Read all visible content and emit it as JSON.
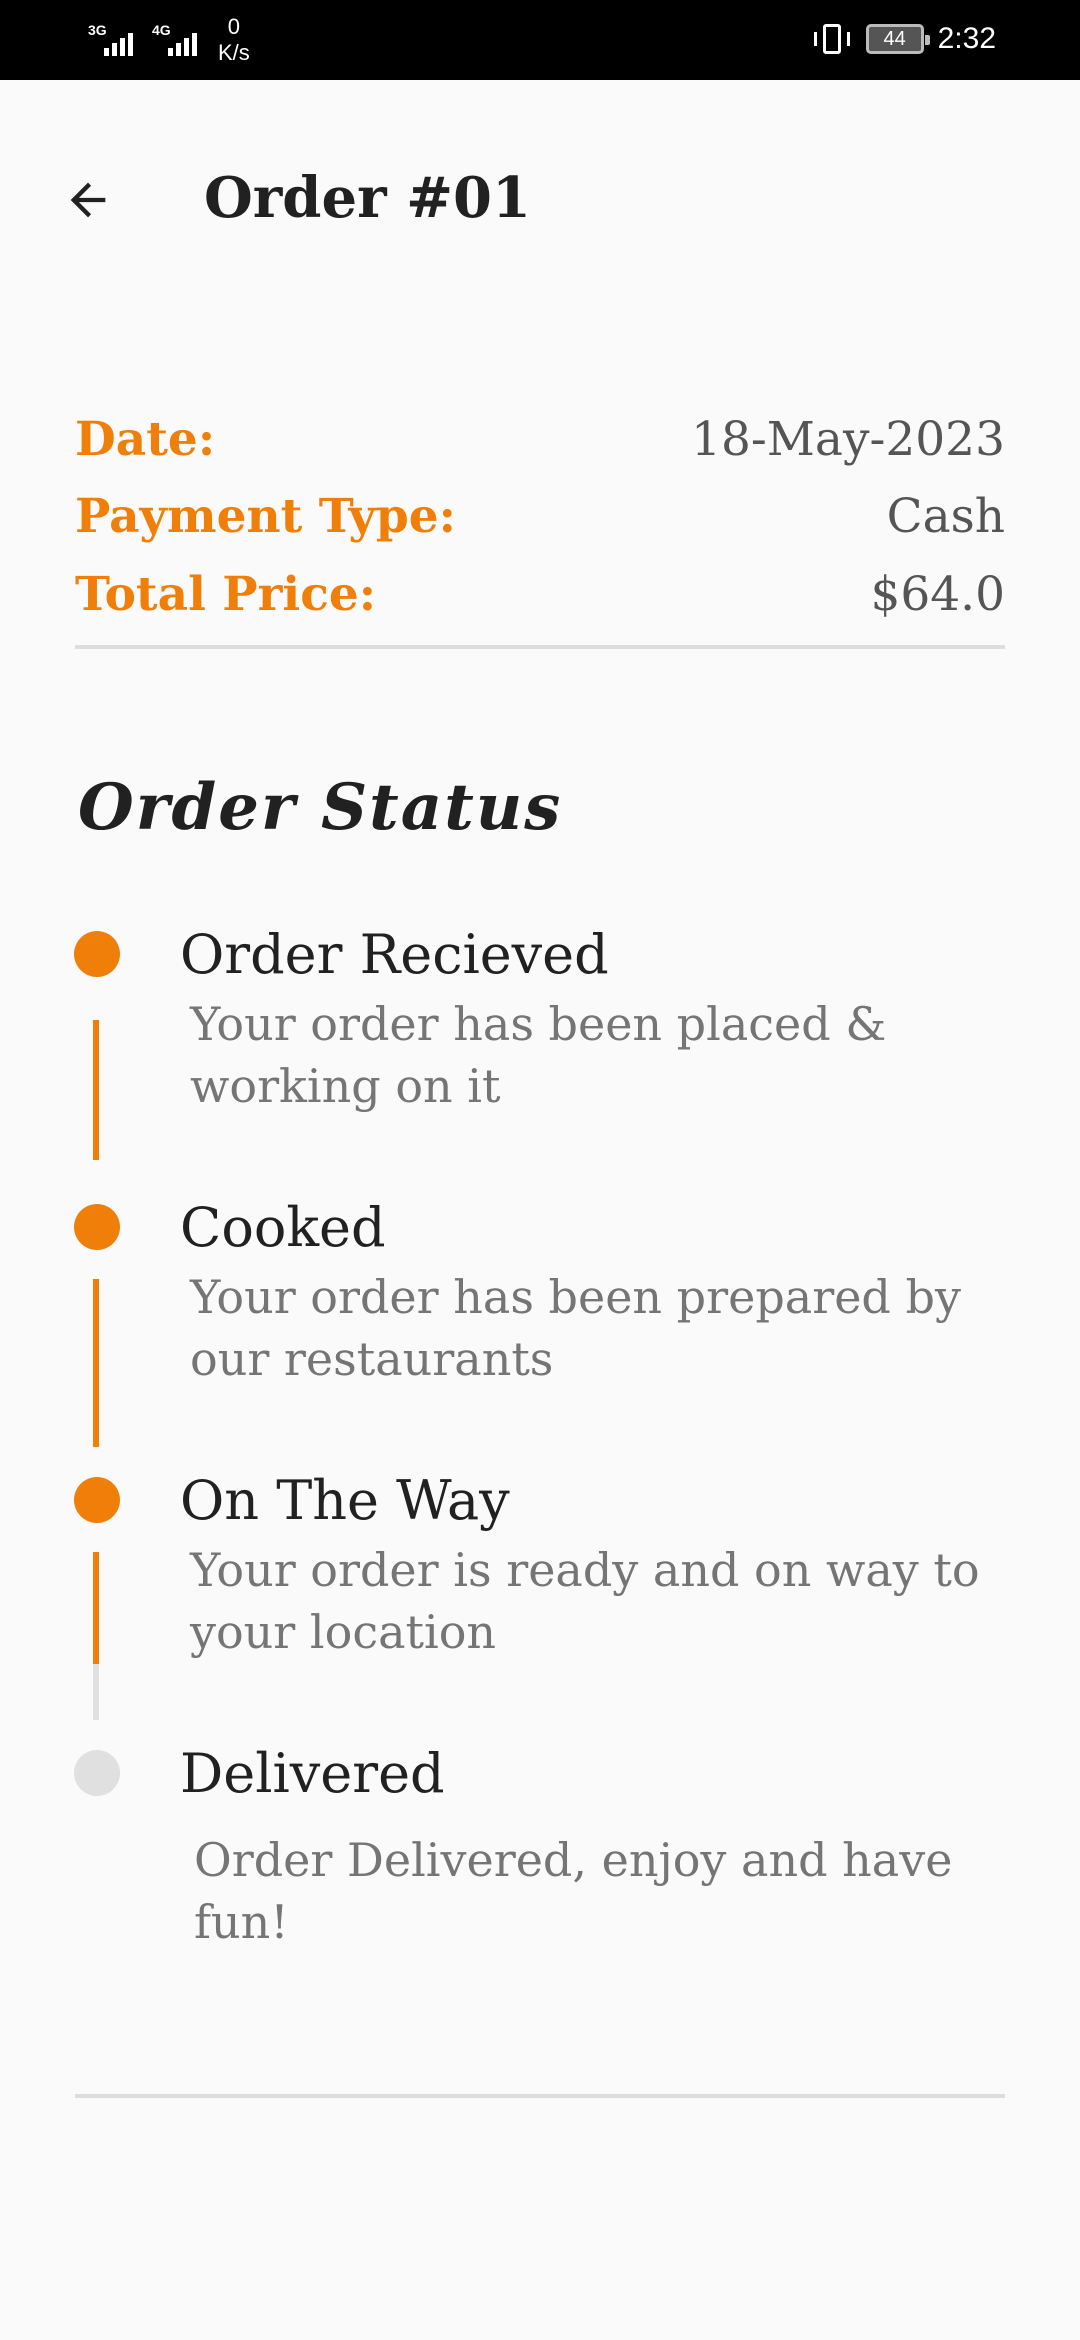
{
  "status_bar": {
    "network1": "3G",
    "network2": "4G",
    "speed_value": "0",
    "speed_unit": "K/s",
    "battery": "44",
    "time": "2:32"
  },
  "header": {
    "back_icon": "arrow-left-icon",
    "title": "Order #01"
  },
  "summary": {
    "date_label": "Date:",
    "date_value": "18-May-2023",
    "payment_label": "Payment Type:",
    "payment_value": "Cash",
    "total_label": "Total Price:",
    "total_value": "$64.0"
  },
  "order_status": {
    "title": "Order Status",
    "steps": [
      {
        "title": "Order Recieved",
        "description_line1": "Your order has been placed &",
        "description_line2": "working on it",
        "done": true
      },
      {
        "title": "Cooked",
        "description_line1": "Your order has been prepared by",
        "description_line2": "our restaurants",
        "done": true
      },
      {
        "title": "On The Way",
        "description_line1": "Your order is ready and on way to",
        "description_line2": "your location",
        "done": true
      },
      {
        "title": "Delivered",
        "description_line1": "Order Delivered, enjoy and have",
        "description_line2": "fun!",
        "done": false
      }
    ]
  },
  "colors": {
    "accent": "#f07f0a",
    "inactive": "#e0e0e0",
    "background": "#fafafa"
  }
}
